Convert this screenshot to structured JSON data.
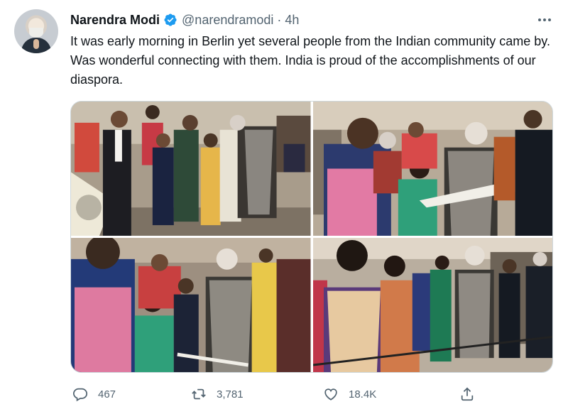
{
  "author": {
    "name": "Narendra Modi",
    "handle": "@narendramodi",
    "separator": "·",
    "time": "4h"
  },
  "tweet": {
    "text": "It was early morning in Berlin yet several people from the Indian community came by. Was wonderful connecting with them. India is proud of the accomplishments of our diaspora."
  },
  "actions": {
    "replies": "467",
    "retweets": "3,781",
    "likes": "18.4K"
  },
  "icons": {
    "verified": "verified-badge-icon",
    "more": "more-options-icon",
    "reply": "reply-icon",
    "retweet": "retweet-icon",
    "like": "heart-icon",
    "share": "share-icon"
  },
  "colors": {
    "verified_blue": "#1d9bf0",
    "text_primary": "#0f1419",
    "text_secondary": "#536471"
  }
}
